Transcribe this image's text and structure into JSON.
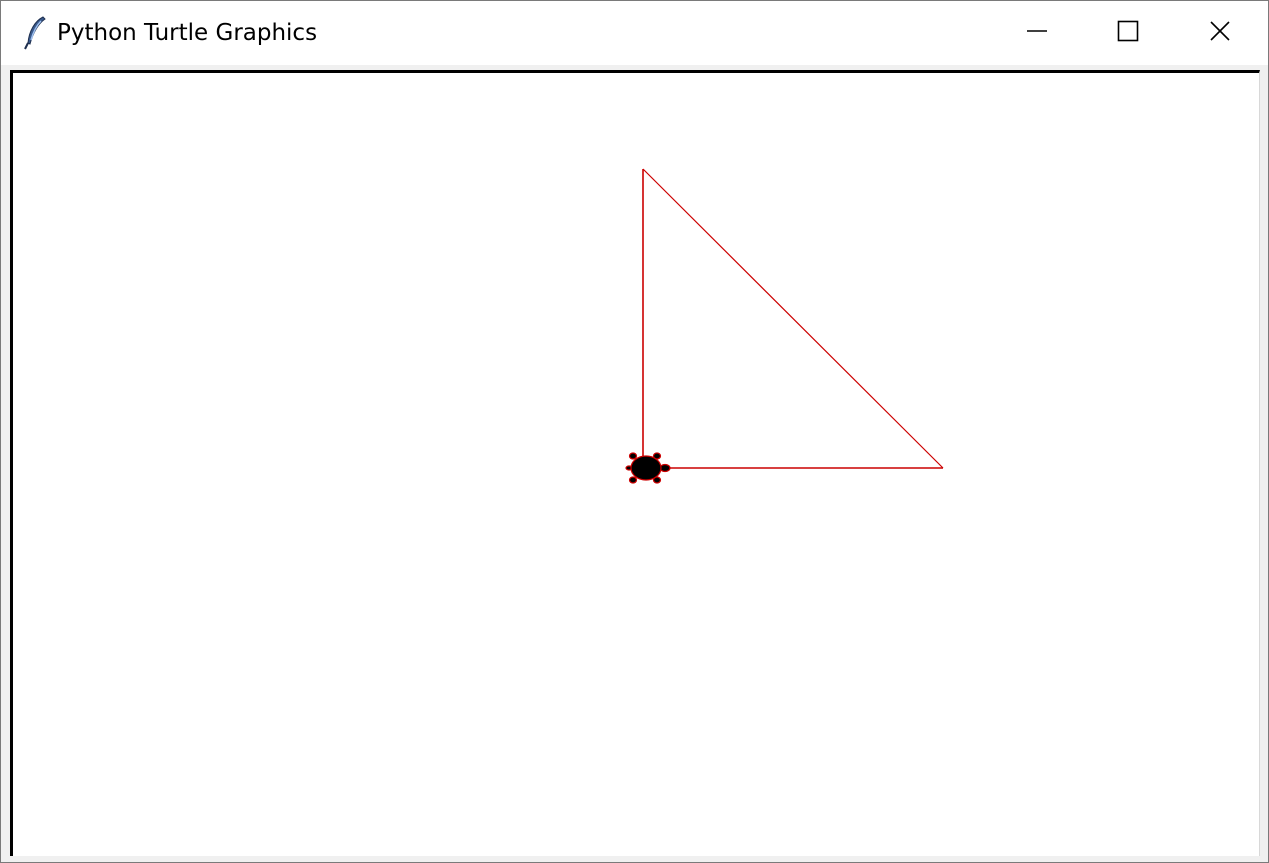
{
  "window": {
    "title": "Python Turtle Graphics",
    "app_icon": "feather-icon",
    "controls": {
      "minimize_icon": "minimize-icon",
      "maximize_icon": "maximize-icon",
      "close_icon": "close-icon"
    }
  },
  "canvas": {
    "background": "#ffffff",
    "pen_color": "#cc0000",
    "turtle_fill": "#000000",
    "turtle_outline": "#cc0000",
    "turtle_icon": "turtle-icon",
    "drawn_shape": "right-triangle"
  }
}
